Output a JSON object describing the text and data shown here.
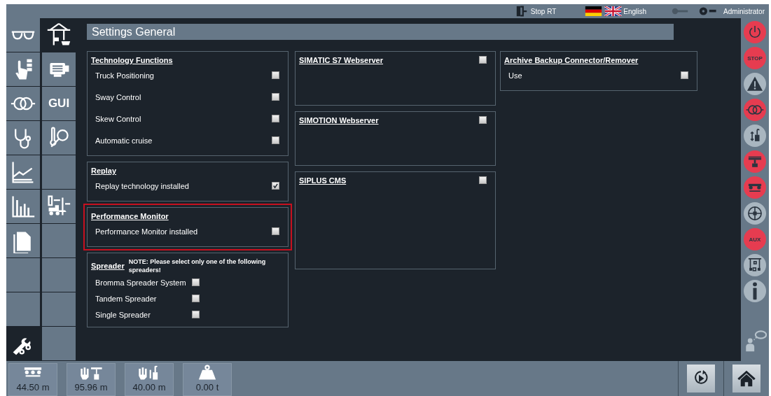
{
  "top_bar": {
    "stop_rt": "Stop RT",
    "language": "English",
    "user": "Administrator"
  },
  "nav_columns": [
    [
      {
        "selected": false
      },
      {
        "selected": false
      },
      {
        "selected": false
      },
      {
        "selected": false
      },
      {
        "selected": false
      },
      {
        "selected": false
      },
      {
        "selected": false
      },
      {
        "selected": false
      },
      {
        "selected": false
      },
      {
        "selected": true
      }
    ],
    [
      {
        "selected": true
      },
      {
        "selected": false
      },
      {
        "label": "GUI",
        "selected": false
      },
      {
        "selected": false
      },
      {
        "selected": false
      },
      {
        "selected": false
      },
      {
        "selected": false
      },
      {
        "selected": false
      },
      {
        "selected": false
      },
      {
        "selected": false
      }
    ]
  ],
  "page_title": "Settings General",
  "columns": [
    [
      {
        "kind": "list",
        "title": "Technology Functions",
        "highlighted": false,
        "items": [
          {
            "label": "Truck Positioning",
            "checked": false
          },
          {
            "label": "Sway Control",
            "checked": false
          },
          {
            "label": "Skew Control",
            "checked": false
          },
          {
            "label": "Automatic cruise",
            "checked": false
          }
        ]
      },
      {
        "kind": "list",
        "title": "Replay",
        "highlighted": false,
        "items": [
          {
            "label": "Replay technology installed",
            "checked": true
          }
        ]
      },
      {
        "kind": "list",
        "title": "Performance Monitor",
        "highlighted": true,
        "items": [
          {
            "label": "Performance Monitor installed",
            "checked": false
          }
        ]
      },
      {
        "kind": "choice",
        "title": "Spreader",
        "note": "NOTE: Please select only one of the following spreaders!",
        "highlighted": false,
        "items": [
          {
            "label": "Bromma Spreader System",
            "checked": false
          },
          {
            "label": "Tandem Spreader",
            "checked": false
          },
          {
            "label": "Single Spreader",
            "checked": false
          }
        ]
      }
    ],
    [
      {
        "kind": "toggle",
        "title": "SIMATIC S7 Webserver",
        "checked": false,
        "highlighted": false
      },
      {
        "kind": "toggle",
        "title": "SIMOTION Webserver",
        "checked": false,
        "highlighted": false
      },
      {
        "kind": "toggle",
        "title": "SIPLUS CMS",
        "checked": false,
        "highlighted": false
      }
    ],
    [
      {
        "kind": "list",
        "title": "Archive Backup Connector/Remover",
        "highlighted": false,
        "items": [
          {
            "label": "Use",
            "checked": false
          }
        ]
      }
    ]
  ],
  "status_buttons": [
    {
      "color": "#e63c50"
    },
    {
      "label": "STOP",
      "color": "#e63c50"
    },
    {
      "color": "#a9b6c0"
    },
    {
      "color": "#e63c50"
    },
    {
      "color": "#a9b6c0"
    },
    {
      "color": "#e63c50"
    },
    {
      "color": "#e63c50"
    },
    {
      "color": "#a9b6c0"
    },
    {
      "label": "AUX",
      "color": "#e63c50"
    },
    {
      "color": "#a9b6c0"
    },
    {
      "color": "#a9b6c0"
    }
  ],
  "readings": [
    {
      "value": "44.50 m"
    },
    {
      "value": "95.96 m"
    },
    {
      "value": "40.00 m"
    },
    {
      "value": "0.00 t"
    }
  ]
}
